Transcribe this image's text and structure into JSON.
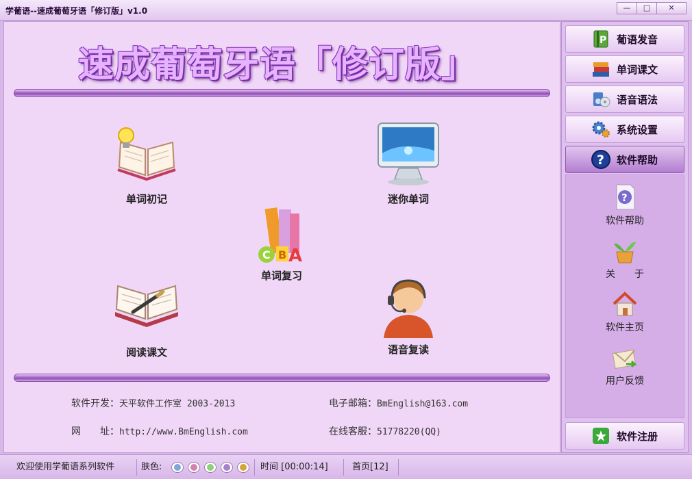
{
  "window": {
    "title": "学葡语--速成葡萄牙语「修订版」v1.0",
    "min": "—",
    "max": "□",
    "close": "✕"
  },
  "banner": {
    "title": "速成葡萄牙语「修订版」"
  },
  "features": {
    "word_first": "单词初记",
    "mini_word": "迷你单词",
    "word_review": "单词复习",
    "read_text": "阅读课文",
    "voice_repeat": "语音复读"
  },
  "info": {
    "dev_label": "软件开发：",
    "dev_value": "天平软件工作室 2003-2013",
    "email_label": "电子邮箱：",
    "email_value": "BmEnglish@163.com",
    "site_label": "网　　址：",
    "site_value": "http://www.BmEnglish.com",
    "support_label": "在线客服：",
    "support_value": "51778220(QQ)"
  },
  "sidebar": {
    "nav": [
      "葡语发音",
      "单词课文",
      "语音语法",
      "系统设置",
      "软件帮助"
    ],
    "sub": [
      "软件帮助",
      "关　　于",
      "软件主页",
      "用户反馈"
    ],
    "register": "软件注册"
  },
  "status": {
    "welcome": "欢迎使用学葡语系列软件",
    "skin_label": "肤色:",
    "time": "时间 [00:00:14]",
    "page": "首页[12]",
    "skins": [
      "#7fa6d6",
      "#d67fb0",
      "#8fd07a",
      "#a77fd0",
      "#d8a23a"
    ]
  },
  "colors": {
    "accent": "#8d4fb2",
    "panel": "#f1d7f7"
  }
}
